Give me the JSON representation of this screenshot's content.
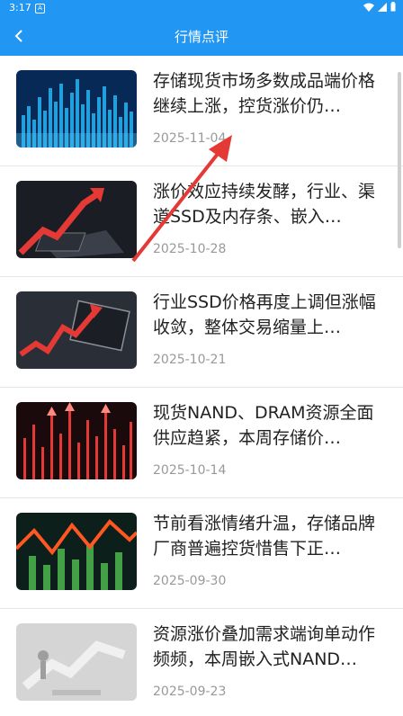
{
  "status": {
    "time": "3:17",
    "notif_glyph": "A"
  },
  "appbar": {
    "title": "行情点评"
  },
  "articles": [
    {
      "title": "存储现货市场多数成品端价格继续上涨，控货涨价仍…",
      "date": "2025-11-04"
    },
    {
      "title": "涨价效应持续发酵，行业、渠道SSD及内存条、嵌入…",
      "date": "2025-10-28"
    },
    {
      "title": "行业SSD价格再度上调但涨幅收敛，整体交易缩量上…",
      "date": "2025-10-21"
    },
    {
      "title": "现货NAND、DRAM资源全面供应趋紧，本周存储价…",
      "date": "2025-10-14"
    },
    {
      "title": "节前看涨情绪升温，存储品牌厂商普遍控货惜售下正…",
      "date": "2025-09-30"
    },
    {
      "title": "资源涨价叠加需求端询单动作频频，本周嵌入式NAND…",
      "date": "2025-09-23"
    }
  ],
  "colors": {
    "primary": "#2196f3",
    "annotation": "#e53935"
  }
}
